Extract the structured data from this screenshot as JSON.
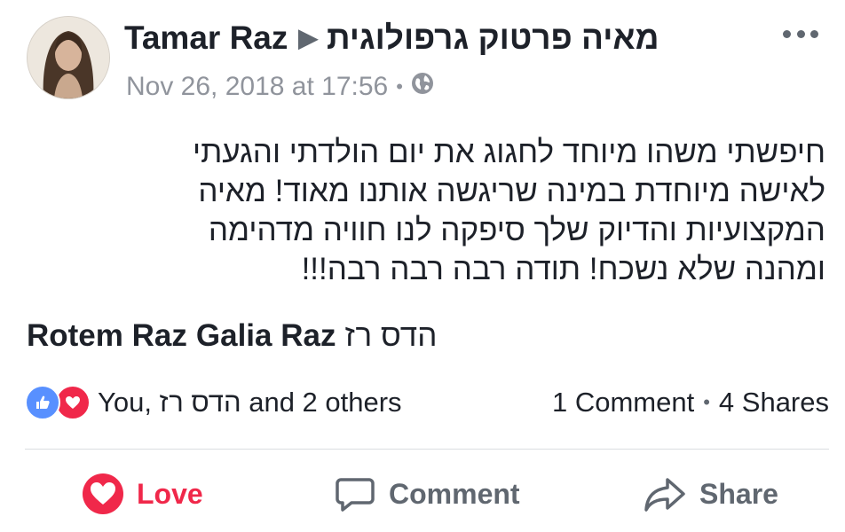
{
  "post": {
    "author": "Tamar Raz",
    "target_page": "מאיה פרטוק גרפולוגית",
    "timestamp": "Nov 26, 2018 at 17:56",
    "privacy_icon": "globe-icon",
    "text_lines": [
      "חיפשתי משהו מיוחד לחגוג את יום הולדתי והגעתי",
      "לאישה מיוחדת במינה שריגשה אותנו מאוד! מאיה",
      "המקצועיות והדיוק שלך סיפקה לנו חוויה מדהימה",
      "ומהנה שלא נשכח! תודה רבה רבה רבה!!!"
    ],
    "tags": [
      "Rotem Raz",
      "Galia Raz",
      "הדס רז"
    ]
  },
  "reactions": {
    "summary": "You, הדס רז and 2 others",
    "icons": [
      "like-icon",
      "love-icon"
    ]
  },
  "counts": {
    "comments": "1 Comment",
    "shares": "4 Shares"
  },
  "actions": {
    "love": "Love",
    "comment": "Comment",
    "share": "Share"
  },
  "colors": {
    "love": "#f0284a",
    "like": "#5890ff",
    "muted": "#606770",
    "meta": "#90949c"
  }
}
